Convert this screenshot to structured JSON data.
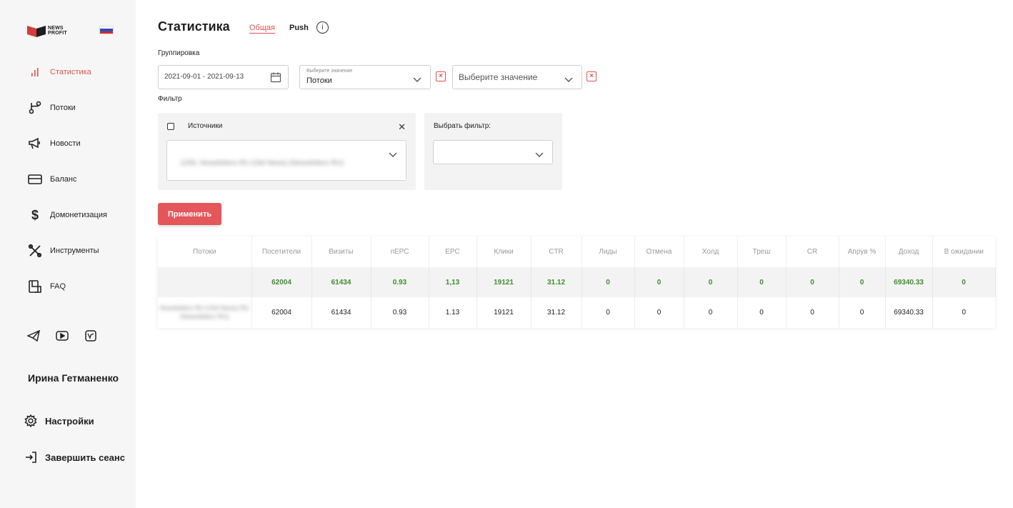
{
  "brand": {
    "logo_text_line1": "NEWS",
    "logo_text_line2": "PROFIT"
  },
  "sidebar": {
    "items": [
      {
        "label": "Статистика",
        "icon": "bar-chart-icon",
        "active": true
      },
      {
        "label": "Потоки",
        "icon": "branch-icon"
      },
      {
        "label": "Новости",
        "icon": "megaphone-icon"
      },
      {
        "label": "Баланс",
        "icon": "card-icon"
      },
      {
        "label": "Домонетизация",
        "icon": "dollar-icon"
      },
      {
        "label": "Инструменты",
        "icon": "tools-icon"
      },
      {
        "label": "FAQ",
        "icon": "faq-icon"
      }
    ],
    "social": [
      "telegram-icon",
      "youtube-icon",
      "vk-icon"
    ],
    "username": "Ирина Гетманенко",
    "settings_label": "Настройки",
    "logout_label": "Завершить сеанс"
  },
  "header": {
    "title": "Статистика",
    "tabs": [
      {
        "label": "Общая",
        "active": true
      },
      {
        "label": "Push"
      }
    ]
  },
  "grouping": {
    "label": "Группировка",
    "date_range": "2021-09-01 - 2021-09-13",
    "select1_placeholder": "Выберите значение",
    "select1_value": "Потоки",
    "select2_value": "Выберите значение"
  },
  "filter": {
    "label": "Фильтр",
    "sources_label": "Источники",
    "sources_value": "1256, Newsletters RU (Old News) (Newsletters RU)",
    "choose_filter_label": "Выбрать фильтр:"
  },
  "apply_label": "Применить",
  "table": {
    "columns": [
      "Потоки",
      "Посетители",
      "Визиты",
      "пЕРС",
      "EPC",
      "Клики",
      "CTR",
      "Лиды",
      "Отмена",
      "Холд",
      "Треш",
      "CR",
      "Апрув %",
      "Доход",
      "В ожидании"
    ],
    "total": [
      "",
      "62004",
      "61434",
      "0.93",
      "1,13",
      "19121",
      "31.12",
      "0",
      "0",
      "0",
      "0",
      "0",
      "0",
      "69340.33",
      "0"
    ],
    "rows": [
      [
        "Newsletters RU (Old News) RU (Newsletters RU)",
        "62004",
        "61434",
        "0.93",
        "1.13",
        "19121",
        "31.12",
        "0",
        "0",
        "0",
        "0",
        "0",
        "0",
        "69340.33",
        "0"
      ]
    ]
  },
  "colors": {
    "accent": "#e2524f",
    "positive": "#3d8f2e"
  }
}
